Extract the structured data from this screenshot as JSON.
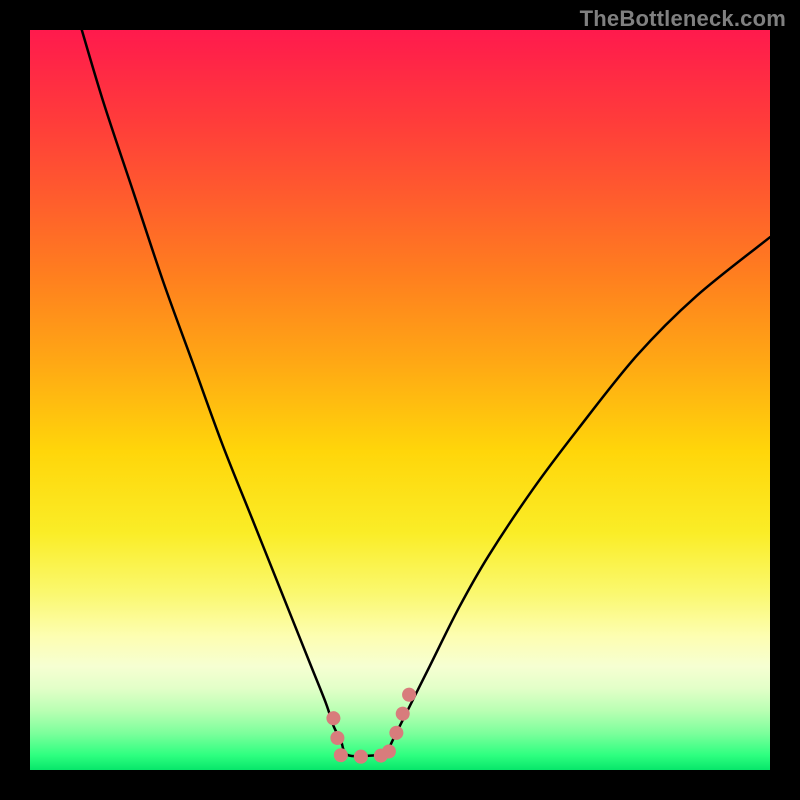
{
  "watermark": "TheBottleneck.com",
  "chart_data": {
    "type": "line",
    "title": "",
    "xlabel": "",
    "ylabel": "",
    "xlim": [
      0,
      100
    ],
    "ylim": [
      0,
      100
    ],
    "grid": false,
    "legend": false,
    "series": [
      {
        "name": "curve",
        "x": [
          7,
          10,
          14,
          18,
          22,
          26,
          30,
          34,
          36,
          38,
          40,
          41,
          42,
          43,
          47,
          48,
          49,
          50,
          52,
          54,
          58,
          62,
          68,
          74,
          82,
          90,
          100
        ],
        "values": [
          100,
          90,
          78,
          66,
          55,
          44,
          34,
          24,
          19,
          14,
          9,
          6,
          4,
          2,
          2,
          2,
          4,
          6,
          10,
          14,
          22,
          29,
          38,
          46,
          56,
          64,
          72
        ]
      }
    ],
    "annotations": [
      {
        "name": "valley-handles-left",
        "pts": [
          [
            41.0,
            7.0
          ],
          [
            41.5,
            4.5
          ],
          [
            42.0,
            2.5
          ]
        ],
        "color": "#d87c7c",
        "width": 14
      },
      {
        "name": "valley-handles-floor",
        "pts": [
          [
            42.0,
            2.0
          ],
          [
            44.0,
            1.8
          ],
          [
            46.0,
            1.8
          ],
          [
            48.0,
            2.0
          ]
        ],
        "color": "#d87c7c",
        "width": 14
      },
      {
        "name": "valley-handles-right",
        "pts": [
          [
            48.5,
            2.5
          ],
          [
            49.5,
            5.0
          ],
          [
            50.5,
            8.0
          ],
          [
            51.5,
            11.0
          ]
        ],
        "color": "#d87c7c",
        "width": 14
      }
    ],
    "colors": {
      "curve": "#000000",
      "handles": "#d87c7c",
      "background_gradient": [
        "#ff1a4d",
        "#ffd60a",
        "#2eff80"
      ]
    }
  }
}
